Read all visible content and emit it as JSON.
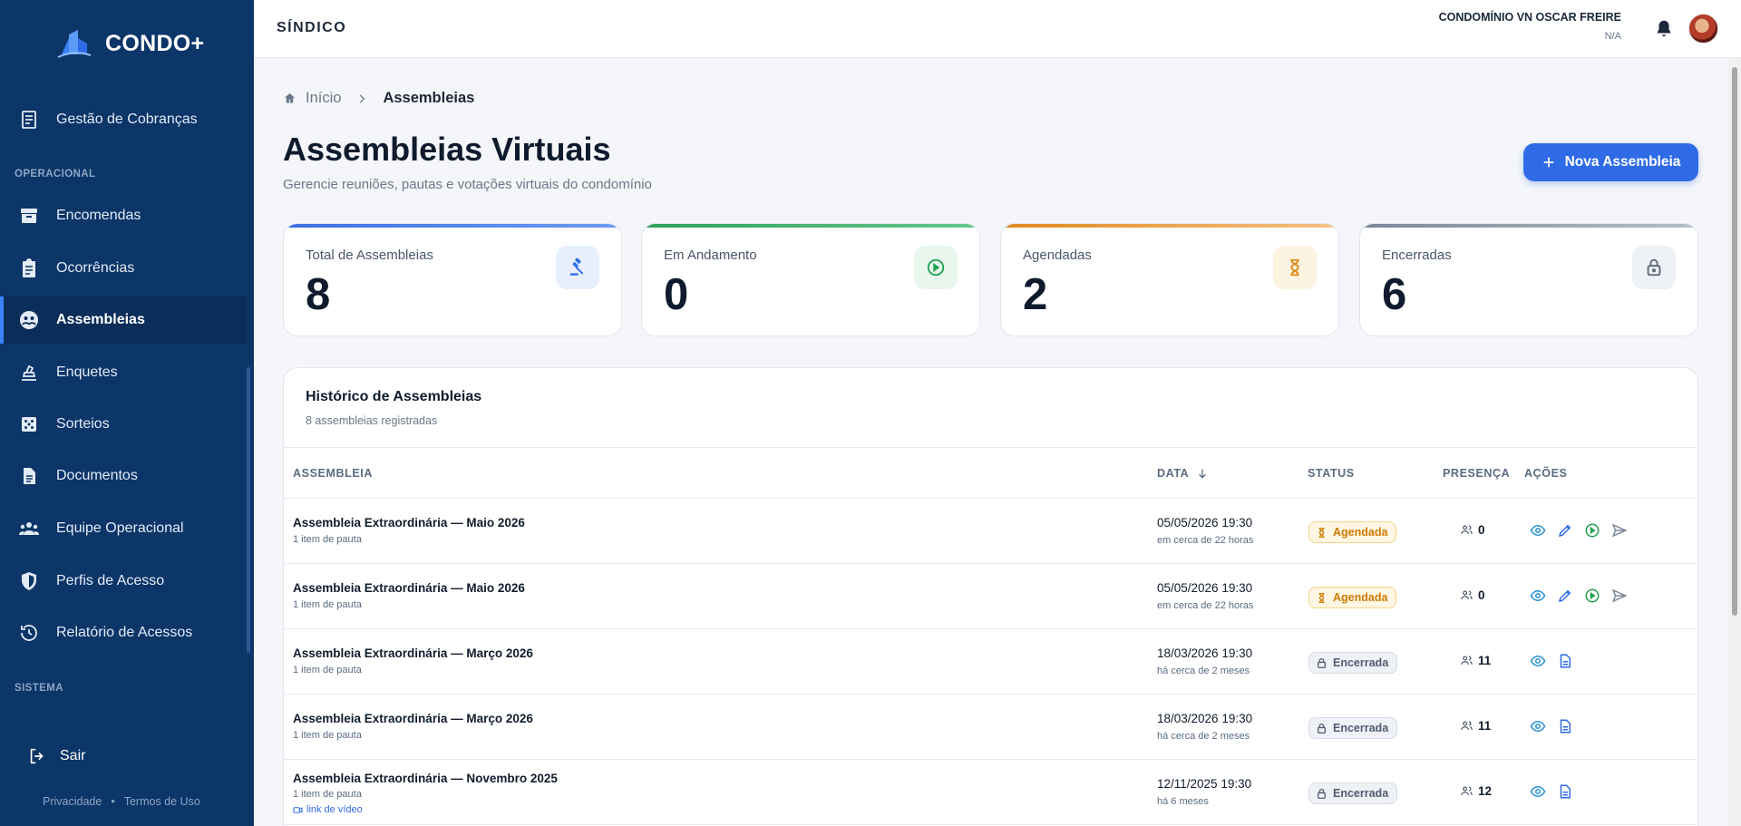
{
  "app": {
    "name": "CONDO+"
  },
  "sidebar": {
    "top_item": "Gestão de Cobranças",
    "section_operational": "OPERACIONAL",
    "items": [
      {
        "label": "Encomendas",
        "icon": "archive-icon"
      },
      {
        "label": "Ocorrências",
        "icon": "clipboard-icon"
      },
      {
        "label": "Assembleias",
        "icon": "group-icon",
        "active": true
      },
      {
        "label": "Enquetes",
        "icon": "ballot-icon"
      },
      {
        "label": "Sorteios",
        "icon": "dice-icon"
      },
      {
        "label": "Documentos",
        "icon": "document-icon"
      },
      {
        "label": "Equipe Operacional",
        "icon": "team-icon"
      },
      {
        "label": "Perfis de Acesso",
        "icon": "shield-icon"
      },
      {
        "label": "Relatório de Acessos",
        "icon": "history-icon"
      }
    ],
    "section_system": "SISTEMA",
    "logout": "Sair",
    "footer": {
      "privacy": "Privacidade",
      "separator": "•",
      "terms": "Termos de Uso"
    }
  },
  "header": {
    "role": "SÍNDICO",
    "condo_name": "CONDOMÍNIO VN OSCAR FREIRE",
    "condo_sub": "N/A"
  },
  "breadcrumb": {
    "home": "Início",
    "current": "Assembleias"
  },
  "page": {
    "title": "Assembleias Virtuais",
    "subtitle": "Gerencie reuniões, pautas e votações virtuais do condomínio",
    "new_button": "Nova Assembleia"
  },
  "stats": [
    {
      "label": "Total de Assembleias",
      "value": "8",
      "color": "#3b6fe0",
      "icon": "gavel-icon"
    },
    {
      "label": "Em Andamento",
      "value": "0",
      "color": "#2ea05a",
      "icon": "play-circle-icon"
    },
    {
      "label": "Agendadas",
      "value": "2",
      "color": "#e08a1e",
      "icon": "hourglass-icon"
    },
    {
      "label": "Encerradas",
      "value": "6",
      "color": "#7d8797",
      "icon": "lock-icon"
    }
  ],
  "history": {
    "title": "Histórico de Assembleias",
    "subtitle": "8 assembleias registradas",
    "columns": {
      "assembly": "ASSEMBLEIA",
      "date": "DATA",
      "status": "STATUS",
      "presence": "PRESENÇA",
      "actions": "AÇÕES"
    },
    "rows": [
      {
        "title": "Assembleia Extraordinária — Maio 2026",
        "items": "1 item de pauta",
        "date": "05/05/2026 19:30",
        "relative": "em cerca de 22 horas",
        "status": "Agendada",
        "presence": "0"
      },
      {
        "title": "Assembleia Extraordinária — Maio 2026",
        "items": "1 item de pauta",
        "date": "05/05/2026 19:30",
        "relative": "em cerca de 22 horas",
        "status": "Agendada",
        "presence": "0"
      },
      {
        "title": "Assembleia Extraordinária — Março 2026",
        "items": "1 item de pauta",
        "date": "18/03/2026 19:30",
        "relative": "há cerca de 2 meses",
        "status": "Encerrada",
        "presence": "11"
      },
      {
        "title": "Assembleia Extraordinária — Março 2026",
        "items": "1 item de pauta",
        "date": "18/03/2026 19:30",
        "relative": "há cerca de 2 meses",
        "status": "Encerrada",
        "presence": "11"
      },
      {
        "title": "Assembleia Extraordinária — Novembro 2025",
        "items": "1 item de pauta",
        "link": "link de vídeo",
        "date": "12/11/2025 19:30",
        "relative": "há 6 meses",
        "status": "Encerrada",
        "presence": "12"
      }
    ]
  }
}
